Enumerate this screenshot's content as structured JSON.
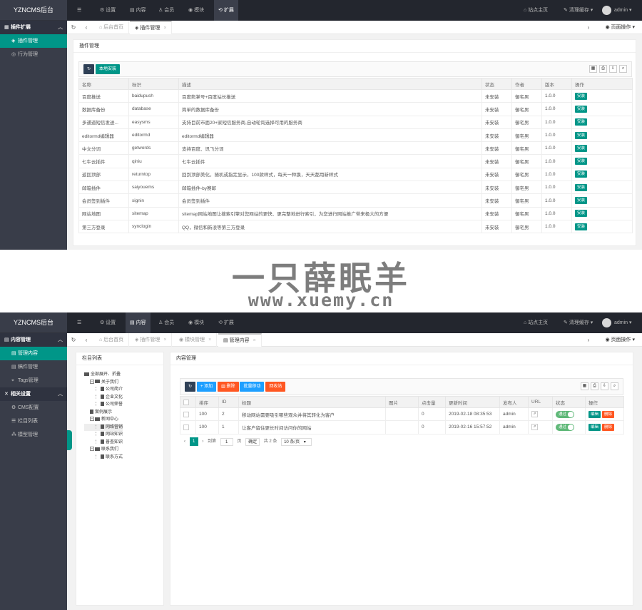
{
  "app": {
    "title": "YZNCMS后台"
  },
  "header": {
    "nav": [
      {
        "icon": "gear-icon",
        "label": "设置"
      },
      {
        "icon": "document-icon",
        "label": "内容"
      },
      {
        "icon": "user-icon",
        "label": "会员"
      },
      {
        "icon": "module-icon",
        "label": "模块"
      },
      {
        "icon": "extension-icon",
        "label": "扩展"
      }
    ],
    "site_home": "站点主页",
    "clear_cache": "清理缓存",
    "user": "admin"
  },
  "page_ops": "页面操作",
  "top": {
    "sidebar": {
      "group": "插件扩展",
      "items": [
        {
          "label": "插件管理"
        },
        {
          "label": "行为管理"
        }
      ]
    },
    "tabs": [
      {
        "label": "后台首页"
      },
      {
        "label": "插件管理"
      }
    ],
    "card_title": "插件管理",
    "toolbar": {
      "install_local": "本地安装"
    },
    "table": {
      "headers": [
        "名称",
        "标识",
        "描述",
        "状态",
        "作者",
        "版本",
        "操作"
      ],
      "rows": [
        [
          "百度推送",
          "baidupush",
          "百度熊掌号+百度站长推送",
          "未安装",
          "御宅男",
          "1.0.0",
          "安装"
        ],
        [
          "数据库备份",
          "database",
          "简单的数据库备份",
          "未安装",
          "御宅男",
          "1.0.0",
          "安装"
        ],
        [
          "多通道短信发送...",
          "easysms",
          "支持目前市面20+家短信服务商,自动轮询选择可用的服务商",
          "未安装",
          "御宅男",
          "1.0.0",
          "安装"
        ],
        [
          "editormd编辑器",
          "editormd",
          "editormd编辑器",
          "未安装",
          "御宅男",
          "1.0.0",
          "安装"
        ],
        [
          "中文分词",
          "getwords",
          "支持百度、讯飞分词",
          "未安装",
          "御宅男",
          "1.0.0",
          "安装"
        ],
        [
          "七牛云插件",
          "qiniu",
          "七牛云插件",
          "未安装",
          "御宅男",
          "1.0.0",
          "安装"
        ],
        [
          "返回顶部",
          "returntop",
          "回到顶部美化，随机或指定显示，100款样式，每天一种换，天天都用新样式",
          "未安装",
          "御宅男",
          "1.0.0",
          "安装"
        ],
        [
          "邮箱插件",
          "saiyouems",
          "邮箱插件-by赛邮",
          "未安装",
          "御宅男",
          "1.0.0",
          "安装"
        ],
        [
          "会员签到插件",
          "signin",
          "会员签到插件",
          "未安装",
          "御宅男",
          "1.0.0",
          "安装"
        ],
        [
          "网站地图",
          "sitemap",
          "sitemap网站地图让搜索引擎对您网站的更快、更完整地进行索引，为您进行网站推广带来极大的方便",
          "未安装",
          "御宅男",
          "1.0.0",
          "安装"
        ],
        [
          "第三方登录",
          "synclogin",
          "QQ，微信和新浪等第三方登录",
          "未安装",
          "御宅男",
          "1.0.0",
          "安装"
        ]
      ]
    }
  },
  "watermark": {
    "title": "一只薛眠羊",
    "url": "www.xuemy.cn"
  },
  "bottom": {
    "sidebar": {
      "groups": [
        {
          "label": "内容管理",
          "items": [
            {
              "label": "管理内容"
            },
            {
              "label": "稿件管理"
            },
            {
              "label": "Tags管理"
            }
          ]
        },
        {
          "label": "相关设置",
          "items": [
            {
              "label": "CMS配置"
            },
            {
              "label": "栏目列表"
            },
            {
              "label": "模型管理"
            }
          ]
        }
      ]
    },
    "tabs": [
      {
        "label": "后台首页"
      },
      {
        "label": "插件管理"
      },
      {
        "label": "模块管理"
      },
      {
        "label": "管理内容"
      }
    ],
    "tree_title": "栏目列表",
    "tree": [
      {
        "label": "全部展开、折叠",
        "level": 0,
        "type": "folder"
      },
      {
        "label": "关于我们",
        "level": 1,
        "type": "folder"
      },
      {
        "label": "公司简介",
        "level": 2,
        "type": "file"
      },
      {
        "label": "企业文化",
        "level": 2,
        "type": "file"
      },
      {
        "label": "公司荣誉",
        "level": 2,
        "type": "file"
      },
      {
        "label": "案例展示",
        "level": 1,
        "type": "file"
      },
      {
        "label": "新闻中心",
        "level": 1,
        "type": "folder"
      },
      {
        "label": "网络营销",
        "level": 2,
        "type": "file"
      },
      {
        "label": "网站知识",
        "level": 2,
        "type": "file"
      },
      {
        "label": "普查知识",
        "level": 2,
        "type": "file"
      },
      {
        "label": "联系我们",
        "level": 1,
        "type": "folder"
      },
      {
        "label": "联系方式",
        "level": 2,
        "type": "file"
      }
    ],
    "content_title": "内容管理",
    "toolbar": {
      "add": "添加",
      "delete": "删除",
      "batch_move": "批量移动",
      "recycle": "回收站"
    },
    "table": {
      "headers": [
        "",
        "排序",
        "ID",
        "标题",
        "图片",
        "点击量",
        "更新时间",
        "发布人",
        "URL",
        "状态",
        "操作"
      ],
      "rows": [
        {
          "sort": "100",
          "id": "2",
          "title": "移动网站需要吸引哪些观众并将其转化为客户",
          "views": "0",
          "updated": "2019-02-18 08:35:53",
          "author": "admin",
          "status": "通过",
          "edit": "编辑",
          "delete": "删除"
        },
        {
          "sort": "100",
          "id": "1",
          "title": "让客户留住更长时间访问你的网站",
          "views": "0",
          "updated": "2019-02-16 15:57:52",
          "author": "admin",
          "status": "通过",
          "edit": "编辑",
          "delete": "删除"
        }
      ]
    },
    "pager": {
      "current": "1",
      "goto_label": "到第",
      "goto_value": "1",
      "page_unit": "页",
      "confirm": "确定",
      "total": "共 2 条",
      "per_page": "10 条/页"
    }
  },
  "colors": {
    "teal": "#009688",
    "dark": "#393d49",
    "blue": "#1e9fff",
    "orange": "#ff5722",
    "green": "#5fb878"
  }
}
